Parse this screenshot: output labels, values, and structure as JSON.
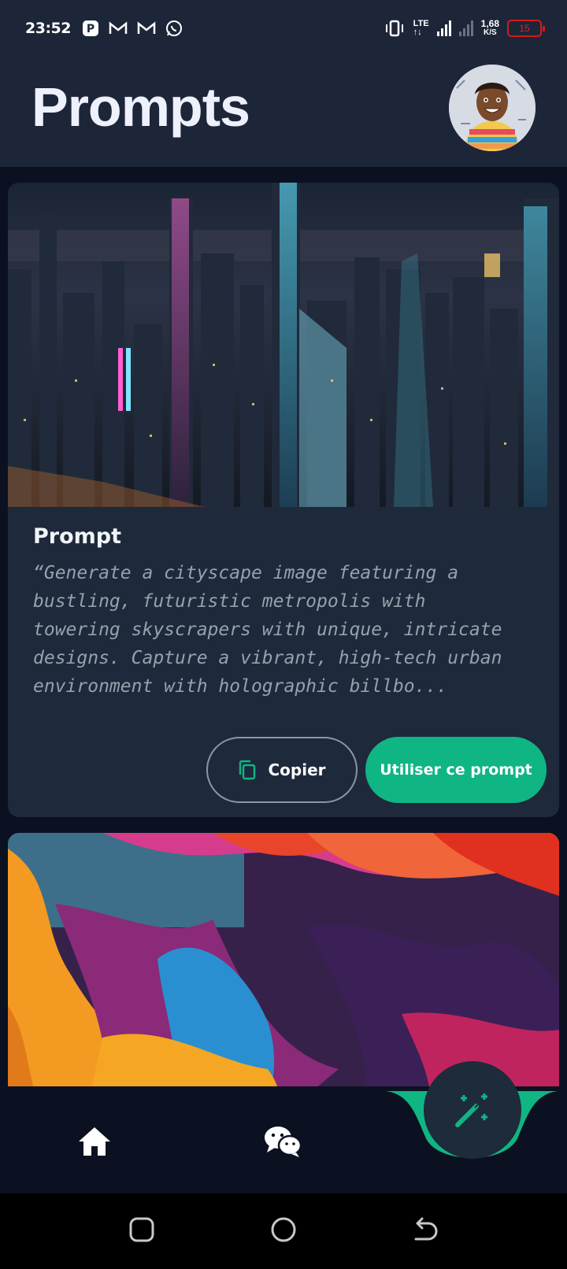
{
  "status_bar": {
    "time": "23:52",
    "lte_label": "LTE",
    "net_speed_value": "1,68",
    "net_speed_unit": "K/S",
    "battery_level": "15",
    "battery_color": "#d01c1c"
  },
  "header": {
    "title": "Prompts"
  },
  "feed": {
    "cards": [
      {
        "title": "Prompt",
        "prompt_text": "“Generate a cityscape image featuring a bustling, futuristic metropolis with towering skyscrapers with unique, intricate designs. Capture a vibrant, high-tech urban environment with holographic billbo...",
        "copy_label": "Copier",
        "use_label": "Utiliser ce prompt"
      }
    ]
  },
  "colors": {
    "accent": "#10b584",
    "card_bg": "#1e293b",
    "page_bg": "#0b1120",
    "header_bg": "#1d2638"
  },
  "bottom_nav": {
    "items": [
      "home-icon",
      "chat-icon",
      "magic-wand-icon"
    ]
  },
  "system_nav": {
    "items": [
      "recents-icon",
      "home-circle-icon",
      "back-icon"
    ]
  }
}
